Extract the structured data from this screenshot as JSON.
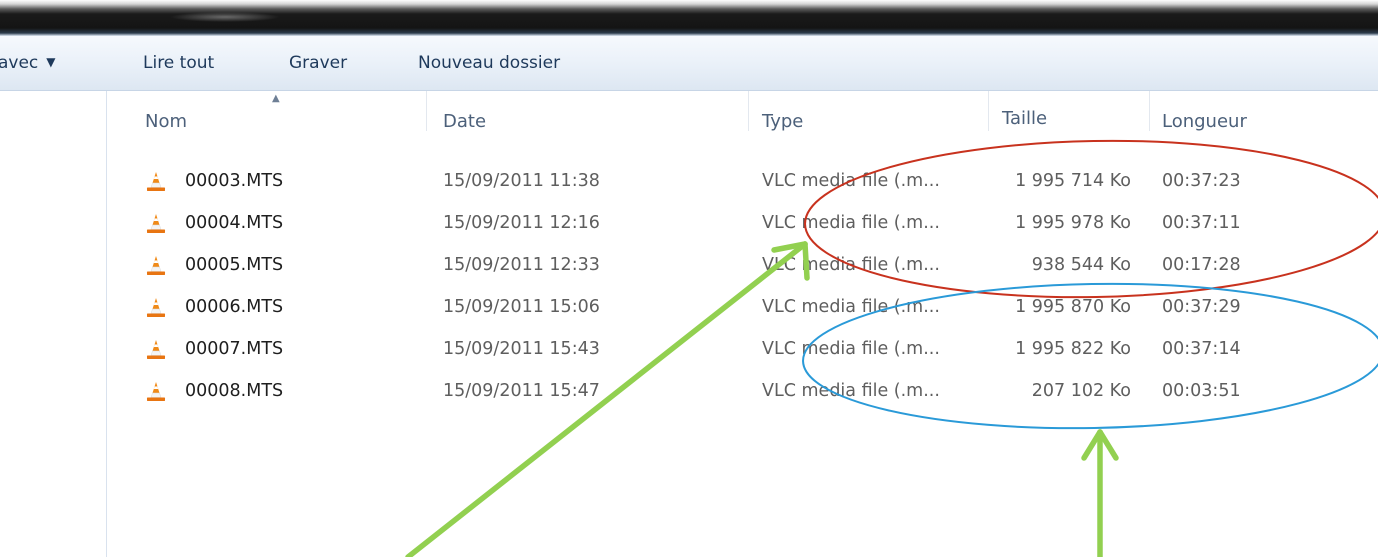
{
  "toolbar": {
    "open_with_label": "avec",
    "play_all_label": "Lire tout",
    "burn_label": "Graver",
    "new_folder_label": "Nouveau dossier"
  },
  "columns": {
    "name": "Nom",
    "date": "Date",
    "type": "Type",
    "size": "Taille",
    "length": "Longueur"
  },
  "files": [
    {
      "icon": "vlc-cone-icon",
      "name": "00003.MTS",
      "date": "15/09/2011 11:38",
      "type": "VLC media file (.m...",
      "size": "1 995 714 Ko",
      "length": "00:37:23"
    },
    {
      "icon": "vlc-cone-icon",
      "name": "00004.MTS",
      "date": "15/09/2011 12:16",
      "type": "VLC media file (.m...",
      "size": "1 995 978 Ko",
      "length": "00:37:11"
    },
    {
      "icon": "vlc-cone-icon",
      "name": "00005.MTS",
      "date": "15/09/2011 12:33",
      "type": "VLC media file (.m...",
      "size": "938 544 Ko",
      "length": "00:17:28"
    },
    {
      "icon": "vlc-cone-icon",
      "name": "00006.MTS",
      "date": "15/09/2011 15:06",
      "type": "VLC media file (.m...",
      "size": "1 995 870 Ko",
      "length": "00:37:29"
    },
    {
      "icon": "vlc-cone-icon",
      "name": "00007.MTS",
      "date": "15/09/2011 15:43",
      "type": "VLC media file (.m...",
      "size": "1 995 822 Ko",
      "length": "00:37:14"
    },
    {
      "icon": "vlc-cone-icon",
      "name": "00008.MTS",
      "date": "15/09/2011 15:47",
      "type": "VLC media file (.m...",
      "size": "207 102 Ko",
      "length": "00:03:51"
    }
  ],
  "annotations": {
    "red_ellipse_color": "#c8321e",
    "blue_ellipse_color": "#2a9ad8",
    "arrow_color": "#92d050"
  }
}
